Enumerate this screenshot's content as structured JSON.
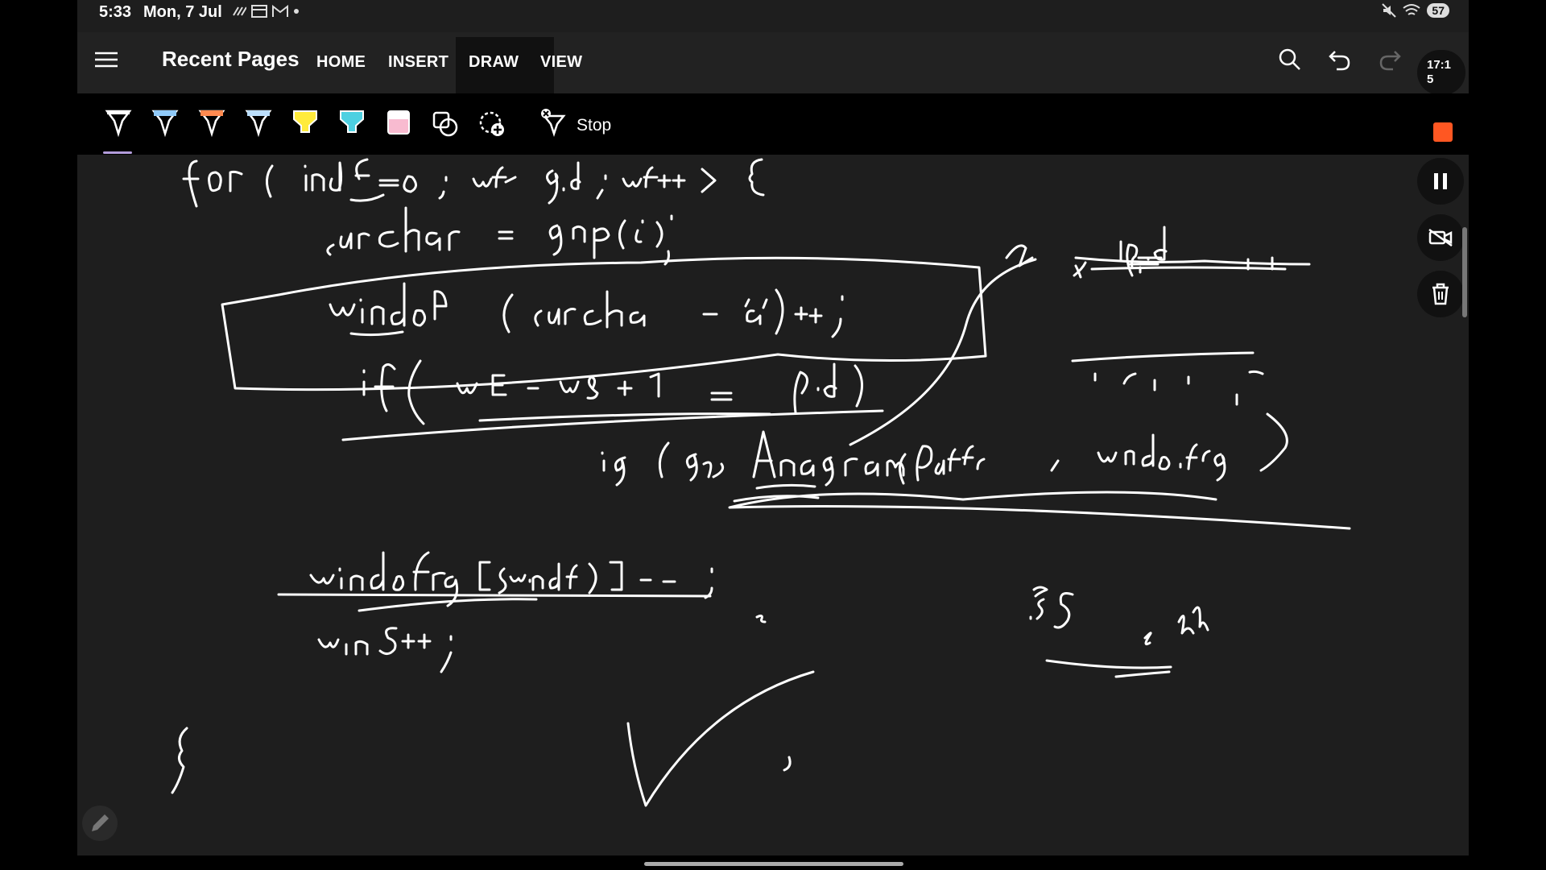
{
  "status_bar": {
    "time": "5:33",
    "date": "Mon, 7 Jul",
    "battery": "57",
    "icons": [
      "signal-icon",
      "calendar-icon",
      "gmail-icon",
      "dot-icon",
      "mute-icon",
      "wifi-icon"
    ]
  },
  "app_bar": {
    "title": "Recent Pages",
    "tabs": [
      {
        "label": "HOME"
      },
      {
        "label": "INSERT"
      },
      {
        "label": "DRAW",
        "active": true
      },
      {
        "label": "VIEW"
      }
    ],
    "timer_line1": "17:1",
    "timer_line2": "5"
  },
  "draw_toolbar": {
    "pen_colors": [
      "#ffffff",
      "#90caf9",
      "#ff8a50",
      "#bbdefb",
      "#ffeb3b",
      "#4dd0e1",
      "#f8bbd0"
    ],
    "stop_label": "Stop"
  },
  "colors": {
    "background": "#1e1e1e",
    "record": "#ff5722",
    "ink": "#ffffff"
  }
}
